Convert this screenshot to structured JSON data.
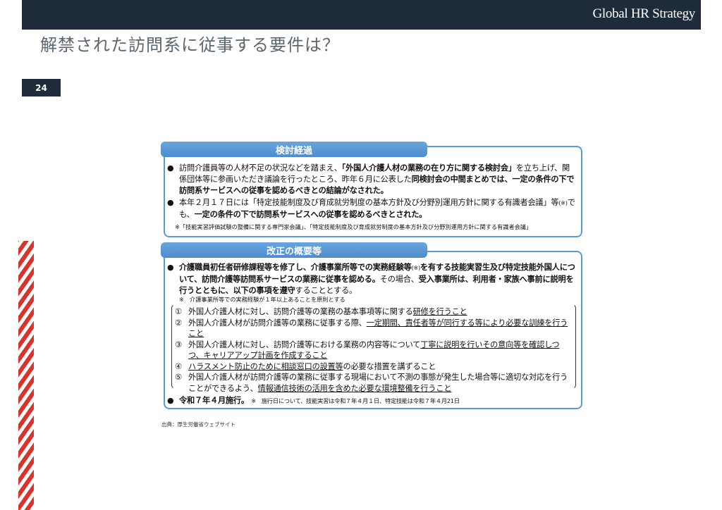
{
  "header": {
    "logo_text": "Global HR Strategy",
    "title": "解禁された訪問系に従事する要件は？",
    "page_number": "24"
  },
  "section1": {
    "heading": "検討経過",
    "bullet1": {
      "seg1": "訪問介護員等の人材不足の状況などを踏まえ、",
      "seg2": "「外国人介護人材の業務の在り方に関する検討会」",
      "seg3": "を立ち上げ、関係団体等に参画いただき議論を行ったところ、昨年６月に公表した",
      "seg4": "同検討会の中間まとめでは、一定の条件の下で訪問系サービスへの従事を認めるべきとの結論がなされた。"
    },
    "bullet2": {
      "seg1": "本年２月１７日には「特定技能制度及び育成就労制度の基本方針及び分野別運用方針に関する有識者会議」等",
      "seg2": "(※)",
      "seg3": "でも、",
      "seg4": "一定の条件の下で訪問系サービスへの従事を認めるべきとされた。"
    },
    "note": "※「技能実習評価試験の整備に関する専門家会議」、「特定技能制度及び育成就労制度の基本方針及び分野別運用方針に関する有識者会議」"
  },
  "section2": {
    "heading": "改正の概要等",
    "bullet1": {
      "seg1": "介護職員初任者研修課程等を修了し、介護事業所等での実務経験等",
      "seg2": "(※)",
      "seg3": "を有する技能実習生及び特定技能外国人について、訪問介護等訪問系サービスの業務に従事を認める。",
      "seg4": "その場合、",
      "seg5": "受入事業所は、利用者・家族へ事前に説明を行うとともに、以下の事項を遵守",
      "seg6": "することとする。"
    },
    "note": "※　介護事業所等での実務経験が１年以上あることを原則とする",
    "items": [
      {
        "num": "①",
        "a": "外国人介護人材に対し、訪問介護等の業務の基本事項等に関する",
        "b": "研修を行うこと",
        "c": ""
      },
      {
        "num": "②",
        "a": "外国人介護人材が訪問介護等の業務に従事する際、",
        "b": "一定期間、責任者等が同行する等により必要な訓練を行うこと",
        "c": ""
      },
      {
        "num": "③",
        "a": "外国人介護人材に対し、訪問介護等における業務の内容等について",
        "b": "丁寧に説明を行いその意向等を確認しつつ、キャリアアップ計画を作成すること",
        "c": ""
      },
      {
        "num": "④",
        "a": "",
        "b": "ハラスメント防止のために相談窓口の設置等",
        "c": "の必要な措置を講ずること"
      },
      {
        "num": "⑤",
        "a": "外国人介護人材が訪問介護等の業務に従事する現場において不測の事態が発生した場合等に適切な対応を行うことができるよう、",
        "b": "情報通信技術の活用を含めた必要な環境整備を行うこと",
        "c": ""
      }
    ],
    "bullet2": {
      "main": "令和７年４月施行。",
      "note": "※　施行日について、技能実習は令和７年４月１日、特定技能は令和７年４月21日"
    }
  },
  "source": "出典：厚生労働省ウェブサイト",
  "colors": {
    "navy": "#1d2b3a",
    "accent_blue": "#5b9bd5",
    "stripe_red": "#d9342b"
  }
}
